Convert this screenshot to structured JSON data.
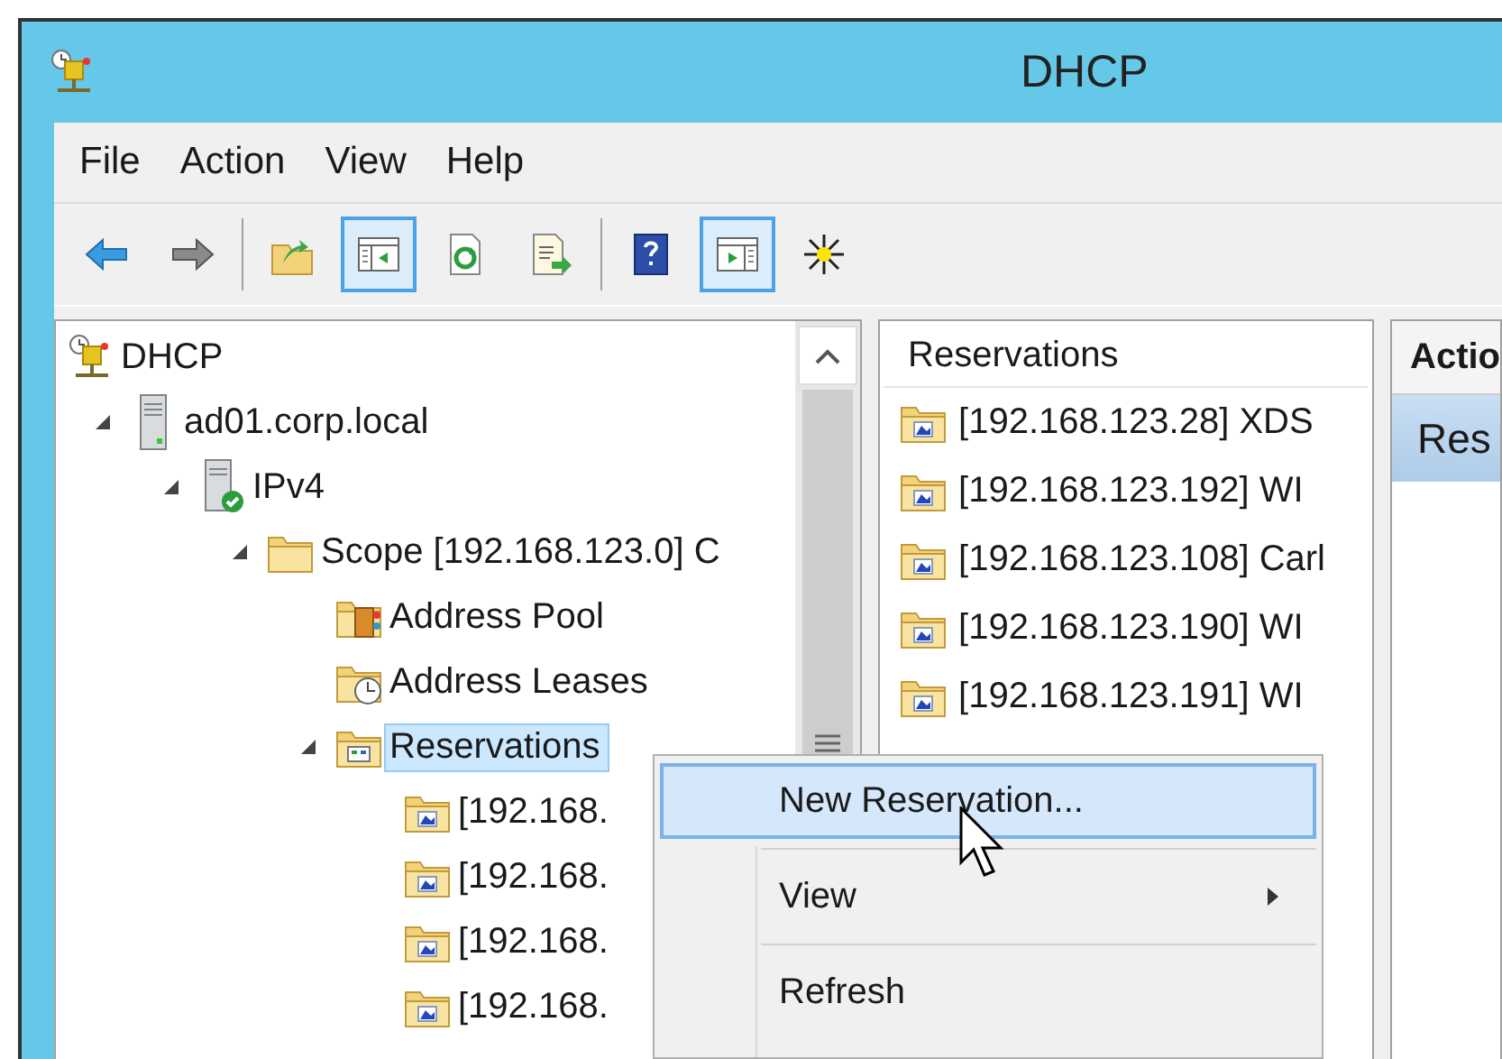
{
  "window": {
    "title": "DHCP"
  },
  "menu_bar": [
    "File",
    "Action",
    "View",
    "Help"
  ],
  "toolbar": {
    "groups": [
      [
        {
          "kind": "back",
          "pressed": false
        },
        {
          "kind": "forward",
          "pressed": false
        }
      ],
      [
        {
          "kind": "up",
          "pressed": false
        },
        {
          "kind": "console-tree",
          "pressed": true
        },
        {
          "kind": "refresh",
          "pressed": false
        },
        {
          "kind": "export",
          "pressed": false
        }
      ],
      [
        {
          "kind": "help",
          "pressed": false
        },
        {
          "kind": "action-pane",
          "pressed": true
        },
        {
          "kind": "new",
          "pressed": false
        }
      ]
    ]
  },
  "tree": [
    {
      "label": "DHCP",
      "kind": "root",
      "selected": false,
      "children": [
        {
          "label": "ad01.corp.local",
          "kind": "server",
          "selected": false,
          "expanded": true,
          "children": [
            {
              "label": "IPv4",
              "kind": "protocol",
              "selected": false,
              "expanded": true,
              "children": [
                {
                  "label": "Scope [192.168.123.0] C",
                  "kind": "scope",
                  "selected": false,
                  "expanded": true,
                  "children": [
                    {
                      "label": "Address Pool",
                      "kind": "pool",
                      "selected": false
                    },
                    {
                      "label": "Address Leases",
                      "kind": "leases",
                      "selected": false
                    },
                    {
                      "label": "Reservations",
                      "kind": "reservations",
                      "selected": true,
                      "expanded": true,
                      "children": [
                        {
                          "label": "[192.168.",
                          "kind": "reservation",
                          "selected": false
                        },
                        {
                          "label": "[192.168.",
                          "kind": "reservation",
                          "selected": false
                        },
                        {
                          "label": "[192.168.",
                          "kind": "reservation",
                          "selected": false
                        },
                        {
                          "label": "[192.168.",
                          "kind": "reservation",
                          "selected": false
                        }
                      ]
                    }
                  ]
                }
              ]
            }
          ]
        }
      ]
    }
  ],
  "list": {
    "header": "Reservations",
    "items": [
      {
        "label": "[192.168.123.28] XDS"
      },
      {
        "label": "[192.168.123.192] WI"
      },
      {
        "label": "[192.168.123.108] Carl"
      },
      {
        "label": "[192.168.123.190] WI"
      },
      {
        "label": "[192.168.123.191] WI"
      }
    ]
  },
  "actions": {
    "header": "Actio",
    "items": [
      {
        "label": "Res",
        "selected": true
      }
    ]
  },
  "context_menu": {
    "items": [
      {
        "kind": "item",
        "label": "New Reservation...",
        "selected": true,
        "submenu": false
      },
      {
        "kind": "separator"
      },
      {
        "kind": "item",
        "label": "View",
        "selected": false,
        "submenu": true
      },
      {
        "kind": "separator"
      },
      {
        "kind": "item",
        "label": "Refresh",
        "selected": false,
        "submenu": false
      }
    ]
  }
}
